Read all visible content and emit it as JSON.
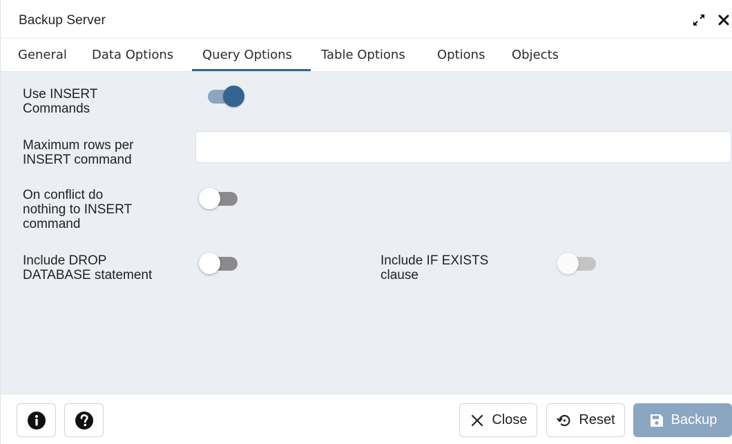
{
  "dialog": {
    "title": "Backup Server"
  },
  "tabs": [
    {
      "label": "General"
    },
    {
      "label": "Data Options"
    },
    {
      "label": "Query Options"
    },
    {
      "label": "Table Options"
    },
    {
      "label": "Options"
    },
    {
      "label": "Objects"
    }
  ],
  "active_tab": "Query Options",
  "fields": {
    "use_insert": {
      "label_line1": "Use INSERT",
      "label_line2": "Commands",
      "value": true
    },
    "max_rows": {
      "label_line1": "Maximum rows per",
      "label_line2": "INSERT command",
      "value": ""
    },
    "on_conflict": {
      "label_line1": "On conflict do",
      "label_line2": "nothing to INSERT",
      "label_line3": "command",
      "value": false
    },
    "drop_database": {
      "label_line1": "Include DROP",
      "label_line2": "DATABASE statement",
      "value": false
    },
    "if_exists": {
      "label_line1": "Include IF EXISTS",
      "label_line2": "clause",
      "value": false,
      "disabled": true
    }
  },
  "footer": {
    "close_label": "Close",
    "reset_label": "Reset",
    "backup_label": "Backup"
  },
  "colors": {
    "accent": "#326690",
    "content_bg": "#ebeef3",
    "backup_button": "#8aa6c1"
  },
  "icons": {
    "expand": "expand-icon",
    "close": "close-icon",
    "info": "info-icon",
    "help": "help-icon",
    "reset": "reset-icon",
    "save": "save-icon"
  }
}
